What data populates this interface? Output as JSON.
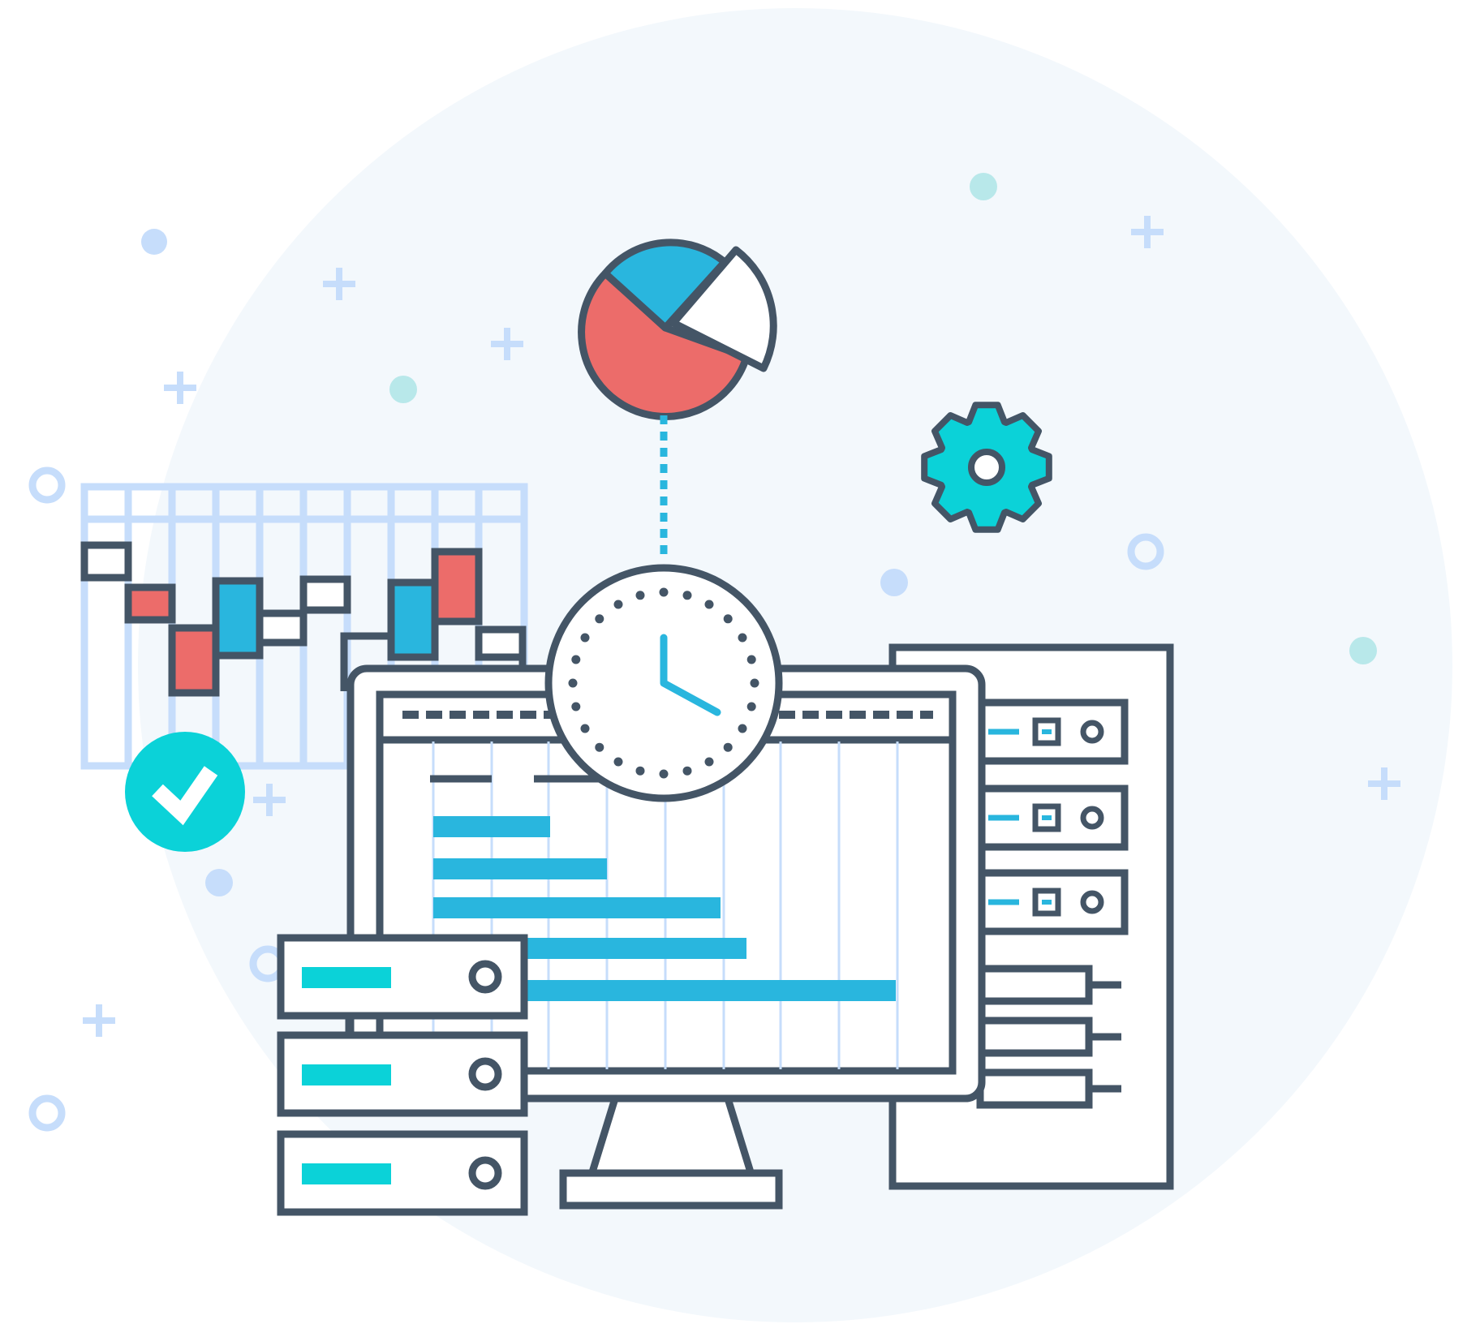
{
  "colors": {
    "background": "#ffffff",
    "backdrop_circle": "#f3f8fc",
    "outline": "#445566",
    "accent_blue": "#29b6de",
    "accent_red": "#ec6c6a",
    "accent_teal": "#0bd2d8",
    "light_blue": "#c6ddfb",
    "mint": "#b8e8ea"
  },
  "icons": {
    "pie_chart": "pie-chart-icon",
    "gear": "gear-icon",
    "clock": "clock-icon",
    "checkmark": "checkmark-badge-icon",
    "monitor": "monitor-icon",
    "server_stack": "server-stack-icon",
    "server_rack": "server-rack-icon",
    "candlestick_chart": "candlestick-chart-icon"
  },
  "pie_chart_slices": [
    {
      "color": "accent_red"
    },
    {
      "color": "accent_blue"
    },
    {
      "color": "white",
      "exploded": true
    }
  ],
  "candlestick_colors": [
    "white",
    "accent_red",
    "accent_red",
    "accent_blue",
    "white",
    "white",
    "accent_blue",
    "accent_red",
    "white"
  ],
  "gantt_bar_count": 5,
  "server_unit_count": 3,
  "rack_unit_count": 3
}
